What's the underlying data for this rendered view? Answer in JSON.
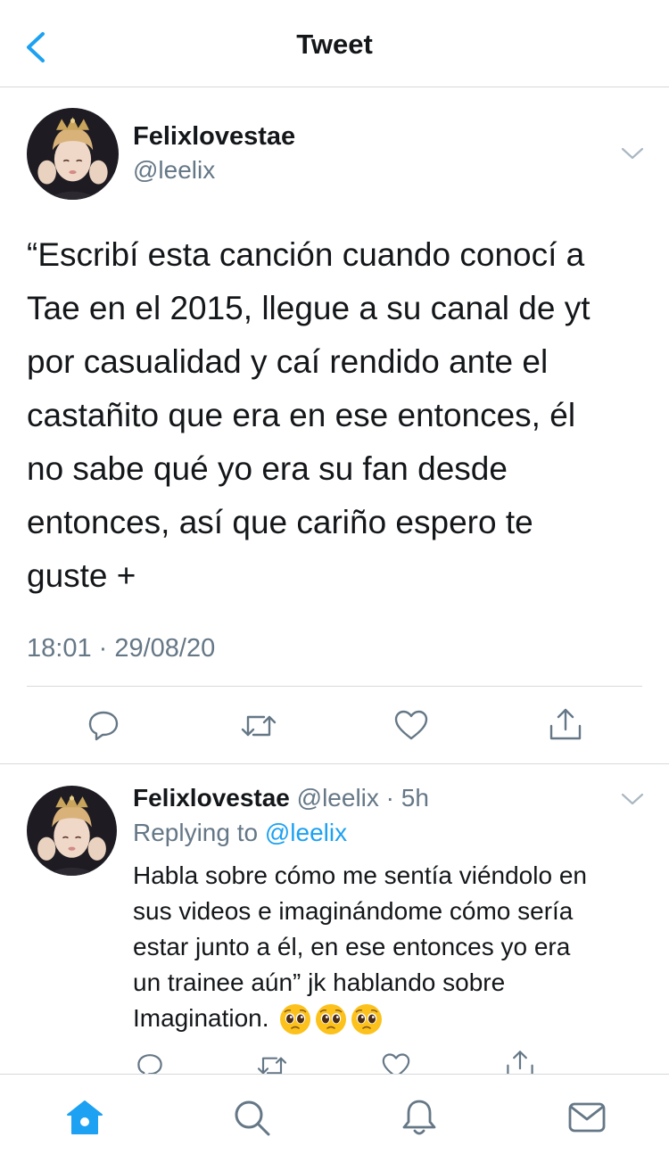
{
  "header": {
    "title": "Tweet"
  },
  "tweet": {
    "name": "Felixlovestae",
    "handle": "@leelix",
    "text_lines": [
      "“Escribí esta canción cuando conocí a",
      "Tae en el 2015, llegue a su canal de yt",
      "por casualidad y caí rendido ante el",
      "castañito que era en ese entonces, él",
      "no sabe qué yo era su fan desde",
      "entonces, así que cariño espero te",
      "guste +"
    ],
    "timestamp": "18:01 · 29/08/20"
  },
  "reply": {
    "name": "Felixlovestae",
    "meta": " @leelix · 5h",
    "replying_prefix": "Replying to ",
    "replying_mention": "@leelix",
    "text_lines": [
      "Habla sobre cómo me sentía viéndolo en",
      "sus videos e imaginándome cómo sería",
      "estar junto a él, en ese entonces yo era",
      "un trainee aún” jk hablando sobre",
      "Imagination. "
    ],
    "emojis": [
      "pleading-face",
      "pleading-face",
      "pleading-face"
    ]
  },
  "actions": [
    "reply-icon",
    "retweet-icon",
    "like-icon",
    "share-icon"
  ],
  "tabs": [
    "home-icon",
    "search-icon",
    "notifications-icon",
    "messages-icon"
  ],
  "colors": {
    "accent": "#1da1f2",
    "secondary_text": "#657786",
    "divider": "#d6d9db"
  }
}
